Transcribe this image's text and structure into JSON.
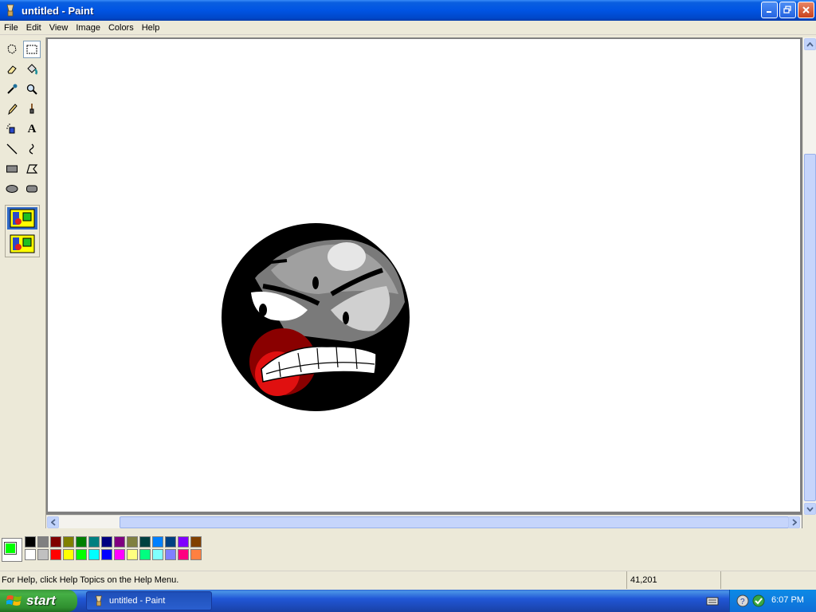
{
  "window": {
    "title": "untitled - Paint"
  },
  "menu": {
    "items": [
      "File",
      "Edit",
      "View",
      "Image",
      "Colors",
      "Help"
    ]
  },
  "tools": [
    {
      "name": "free-form-select-icon"
    },
    {
      "name": "rect-select-icon"
    },
    {
      "name": "eraser-icon"
    },
    {
      "name": "fill-icon"
    },
    {
      "name": "color-picker-icon"
    },
    {
      "name": "magnifier-icon"
    },
    {
      "name": "pencil-icon"
    },
    {
      "name": "brush-icon"
    },
    {
      "name": "airbrush-icon"
    },
    {
      "name": "text-icon"
    },
    {
      "name": "line-icon"
    },
    {
      "name": "curve-icon"
    },
    {
      "name": "rectangle-icon"
    },
    {
      "name": "polygon-icon"
    },
    {
      "name": "ellipse-icon"
    },
    {
      "name": "rounded-rect-icon"
    }
  ],
  "text_tool_label": "A",
  "palette": {
    "current_foreground": "#00ff00",
    "current_background": "#ffffff",
    "top_row": [
      "#000000",
      "#808080",
      "#800000",
      "#808000",
      "#008000",
      "#008080",
      "#000080",
      "#800080",
      "#808040",
      "#004040",
      "#0080ff",
      "#004080",
      "#8000ff",
      "#804000"
    ],
    "bottom_row": [
      "#ffffff",
      "#c0c0c0",
      "#ff0000",
      "#ffff00",
      "#00ff00",
      "#00ffff",
      "#0000ff",
      "#ff00ff",
      "#ffff80",
      "#00ff80",
      "#80ffff",
      "#8080ff",
      "#ff0080",
      "#ff8040"
    ]
  },
  "status": {
    "help_text": "For Help, click Help Topics on the Help Menu.",
    "coordinates": "41,201"
  },
  "taskbar": {
    "start_label": "start",
    "task_label": "untitled - Paint",
    "clock": "6:07 PM"
  }
}
